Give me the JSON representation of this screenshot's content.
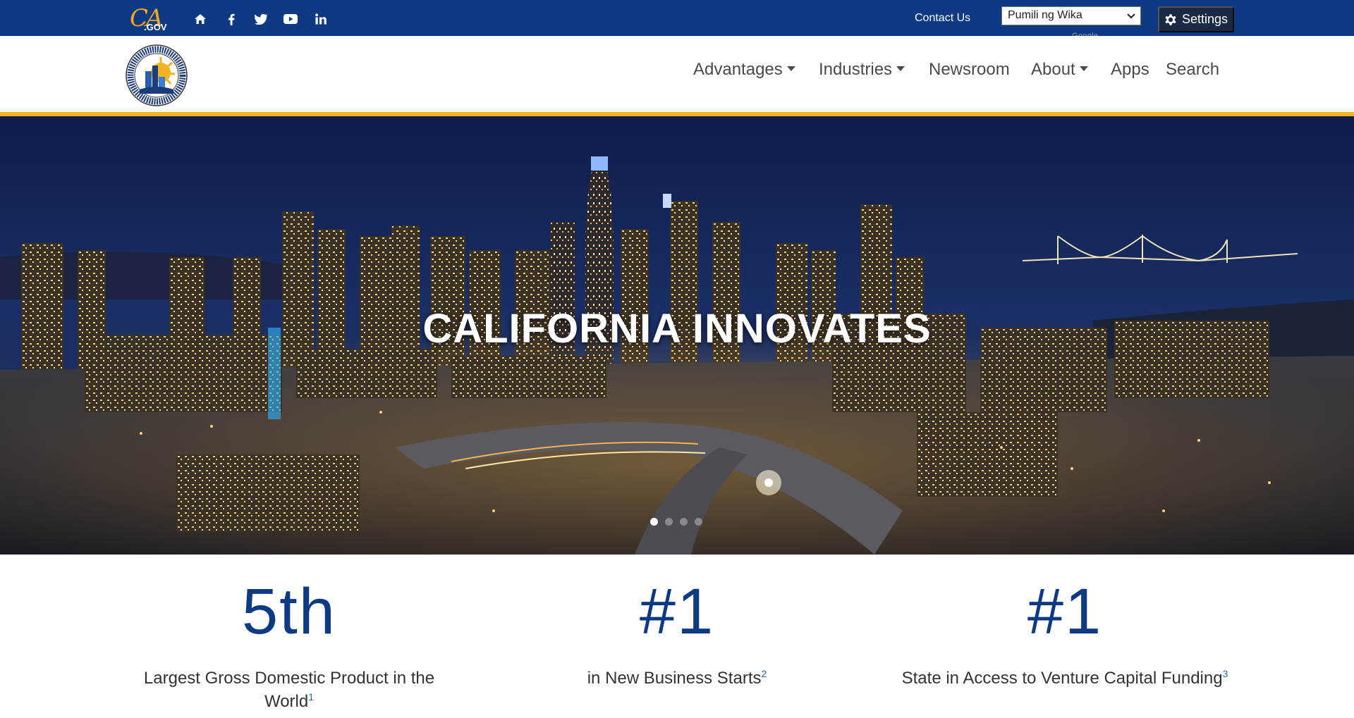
{
  "utility": {
    "logo_ca": "CA",
    "logo_gov": ".GOV",
    "social_icons": [
      "home-icon",
      "facebook-icon",
      "twitter-icon",
      "youtube-icon",
      "linkedin-icon"
    ],
    "contact_label": "Contact Us",
    "language_select_value": "Pumili ng Wika",
    "google_label": "Google",
    "settings_label": "Settings"
  },
  "nav": {
    "items": [
      {
        "label": "Advantages",
        "dropdown": true
      },
      {
        "label": "Industries",
        "dropdown": true
      },
      {
        "label": "Newsroom",
        "dropdown": false
      },
      {
        "label": "About",
        "dropdown": true
      },
      {
        "label": "Apps",
        "dropdown": false
      },
      {
        "label": "Search",
        "dropdown": false
      }
    ]
  },
  "hero": {
    "title": "CALIFORNIA INNOVATES",
    "slide_count": 4,
    "active_slide": 1
  },
  "stats": [
    {
      "value": "5th",
      "text": "Largest Gross Domestic Product in the World",
      "footnote": "1"
    },
    {
      "value": "#1",
      "text": "in New Business Starts",
      "footnote": "2"
    },
    {
      "value": "#1",
      "text": "State in Access to Venture Capital Funding",
      "footnote": "3"
    }
  ],
  "colors": {
    "utility_bar": "#0d3a82",
    "accent_gold": "#f4b320",
    "stat_blue": "#0d3a82",
    "settings_button": "#1b2a44"
  }
}
